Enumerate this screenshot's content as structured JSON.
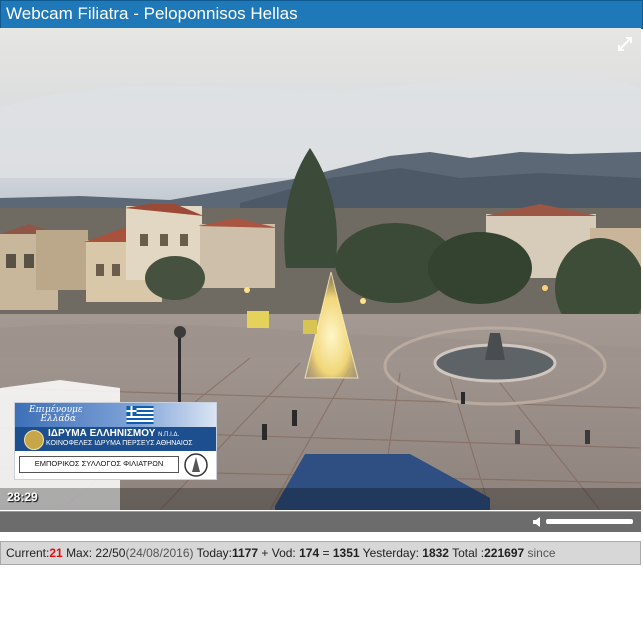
{
  "window": {
    "title": "Webcam Filiatra - Peloponnisos Hellas"
  },
  "player": {
    "timestamp": "28:29",
    "expand_icon": "expand-icon",
    "volume_icon": "volume-icon",
    "volume_level": 0.95
  },
  "banner": {
    "motto_line1": "Επιμένουμε",
    "motto_line2": "Ελλάδα",
    "org_name": "ΙΔΡΥΜΑ ΕΛΛΗΝΙΣΜΟΥ",
    "org_suffix": "Ν.Π.Ι.Δ.",
    "org_subtitle": "ΚΟΙΝΟΦΕΛΕΣ ΙΔΡΥΜΑ ΠΕΡΣΕΥΣ ΑΘΗΝΑΙΟΣ",
    "association": "ΕΜΠΟΡΙΚΟΣ ΣΥΛΛΟΓΟΣ ΦΙΛΙΑΤΡΩΝ"
  },
  "stats": {
    "current_label": "Current:",
    "current_value": "21",
    "max_label": "Max:",
    "max_value": "22/50",
    "max_date": "(24/08/2016)",
    "today_label": "Today:",
    "today_value": "1177",
    "vod_label": "+ Vod:",
    "vod_value": "174",
    "equals": "=",
    "sum_value": "1351",
    "yesterday_label": "Yesterday:",
    "yesterday_value": "1832",
    "total_label": "Total :",
    "total_value": "221697",
    "since_label": "since"
  },
  "colors": {
    "title_bar": "#1f78b8",
    "control_bar": "#6c6c6c",
    "stats_bar": "#d7d7d7",
    "current_value": "#e01010"
  }
}
